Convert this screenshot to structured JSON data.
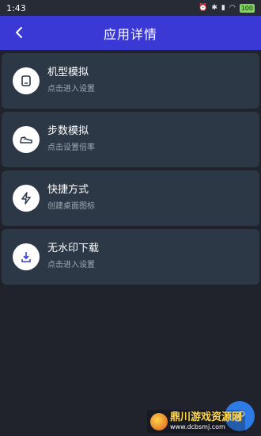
{
  "status": {
    "time": "1:43",
    "battery": "100"
  },
  "header": {
    "title": "应用详情"
  },
  "items": [
    {
      "title": "机型模拟",
      "subtitle": "点击进入设置",
      "icon": "phone-icon"
    },
    {
      "title": "步数模拟",
      "subtitle": "点击设置倍率",
      "icon": "shoe-icon"
    },
    {
      "title": "快捷方式",
      "subtitle": "创建桌面图标",
      "icon": "lightning-icon"
    },
    {
      "title": "无水印下载",
      "subtitle": "点击进入设置",
      "icon": "download-icon"
    }
  ],
  "watermark": {
    "name": "鼎川游戏资源网",
    "url": "www.dcbsmj.com"
  },
  "colors": {
    "appbar": "#3b39d6",
    "background": "#20232c",
    "card": "#2c3845",
    "fab": "#2f7be5"
  }
}
